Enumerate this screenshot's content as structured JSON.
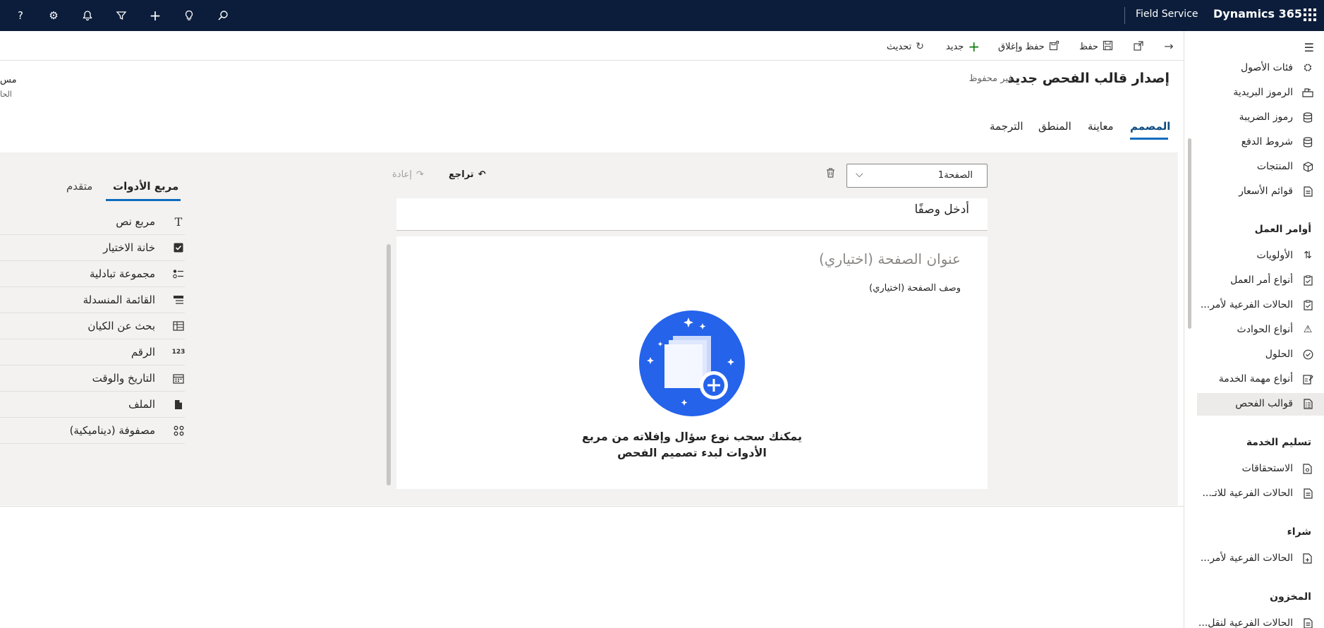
{
  "topbar": {
    "app_name": "Field Service",
    "brand": "Dynamics 365",
    "icons": [
      "help-icon",
      "gear-icon",
      "bell-icon",
      "filter-icon",
      "plus-icon",
      "lightbulb-icon",
      "search-icon",
      "waffle-icon"
    ]
  },
  "commands": {
    "refresh": "تحديث",
    "new": "جديد",
    "save_close": "حفظ وإغلاق",
    "save": "حفظ"
  },
  "header": {
    "title": "إصدار قالب الفحص جديد",
    "status": "- غير محفوظ",
    "truncated_1": "مس",
    "truncated_2": "الحا"
  },
  "tabs": [
    "المصمم",
    "معاينة",
    "المنطق",
    "الترجمة"
  ],
  "designer": {
    "page_select_value": "الصفحة1",
    "undo": "تراجع",
    "redo": "إعادة",
    "description_placeholder": "أدخل وصفًا",
    "page_title_placeholder": "عنوان الصفحة (اختياري)",
    "page_desc_placeholder": "وصف الصفحة (اختياري)",
    "empty_line1": "يمكنك سحب نوع سؤال وإفلاته من مربع",
    "empty_line2": "الأدوات لبدء تصميم الفحص"
  },
  "toolbox": {
    "tabs": [
      "مربع الأدوات",
      "متقدم"
    ],
    "items": [
      {
        "label": "مربع نص",
        "icon": "text-icon"
      },
      {
        "label": "خانة الاختيار",
        "icon": "checkbox-icon"
      },
      {
        "label": "مجموعة تبادلية",
        "icon": "radio-group-icon"
      },
      {
        "label": "القائمة المنسدلة",
        "icon": "dropdown-icon"
      },
      {
        "label": "بحث عن الكيان",
        "icon": "entity-lookup-icon"
      },
      {
        "label": "الرقم",
        "icon": "number-icon"
      },
      {
        "label": "التاريخ والوقت",
        "icon": "calendar-icon"
      },
      {
        "label": "الملف",
        "icon": "file-icon"
      },
      {
        "label": "مصفوفة (ديناميكية)",
        "icon": "matrix-icon"
      }
    ]
  },
  "sitemap": {
    "items_top": [
      {
        "label": "فئات الأصول",
        "icon": "asset-category-icon"
      },
      {
        "label": "الرموز البريدية",
        "icon": "postal-code-icon"
      },
      {
        "label": "رموز الضريبة",
        "icon": "tax-code-icon"
      },
      {
        "label": "شروط الدفع",
        "icon": "payment-terms-icon"
      },
      {
        "label": "المنتجات",
        "icon": "product-icon"
      },
      {
        "label": "قوائم الأسعار",
        "icon": "price-list-icon"
      }
    ],
    "group_work_orders": "أوامر العمل",
    "items_work_orders": [
      {
        "label": "الأولويات",
        "icon": "priority-icon"
      },
      {
        "label": "أنواع أمر العمل",
        "icon": "work-order-type-icon"
      },
      {
        "label": "الحالات الفرعية لأمر...",
        "icon": "substatus-icon"
      },
      {
        "label": "أنواع الحوادث",
        "icon": "incident-type-icon"
      },
      {
        "label": "الحلول",
        "icon": "resolution-icon"
      },
      {
        "label": "أنواع مهمة الخدمة",
        "icon": "service-task-type-icon"
      },
      {
        "label": "قوالب الفحص",
        "icon": "inspection-template-icon"
      }
    ],
    "group_service_delivery": "تسليم الخدمة",
    "items_service_delivery": [
      {
        "label": "الاستحقاقات",
        "icon": "entitlement-icon"
      },
      {
        "label": "الحالات الفرعية للاتـ...",
        "icon": "agreement-substatus-icon"
      }
    ],
    "group_purchase": "شراء",
    "items_purchase": [
      {
        "label": "الحالات الفرعية لأمر...",
        "icon": "po-substatus-icon"
      }
    ],
    "group_inventory": "المخزون",
    "items_inventory": [
      {
        "label": "الحالات الفرعية لنقل...",
        "icon": "transfer-substatus-icon"
      }
    ]
  }
}
